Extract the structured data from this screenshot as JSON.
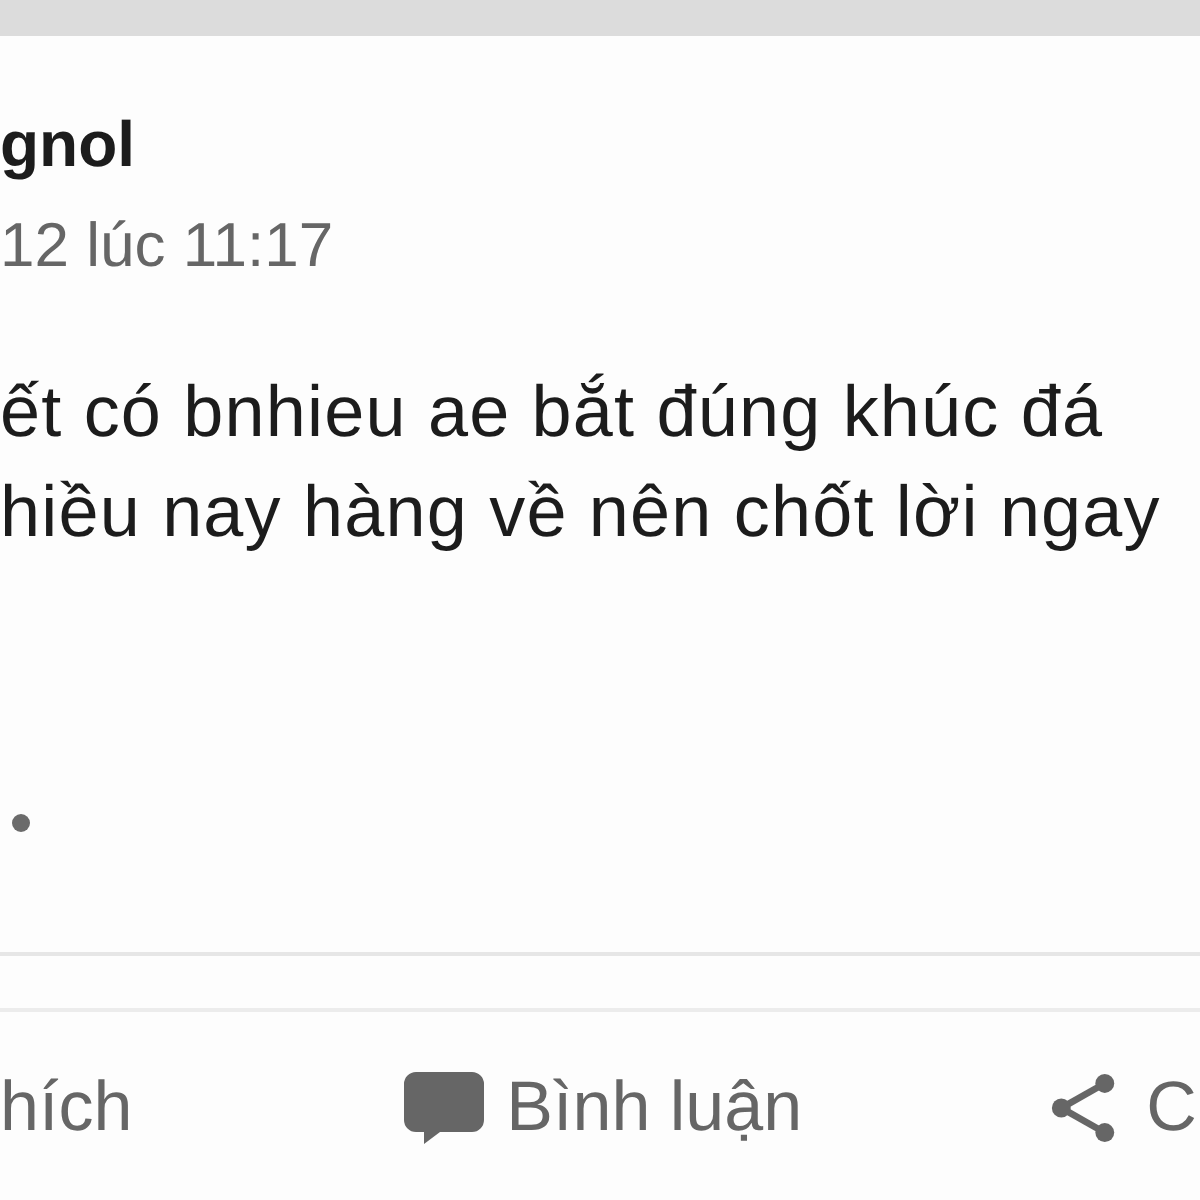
{
  "post": {
    "author": "gnol",
    "timestamp": "12 lúc 11:17",
    "body_lines": [
      "ết có bnhieu ae bắt đúng khúc đá",
      "hiều nay hàng về nên chốt lời ngay"
    ]
  },
  "actions": [
    {
      "kind": "like",
      "label": "hích"
    },
    {
      "kind": "comment",
      "label": "Bình luận"
    },
    {
      "kind": "share",
      "label": "C"
    }
  ]
}
